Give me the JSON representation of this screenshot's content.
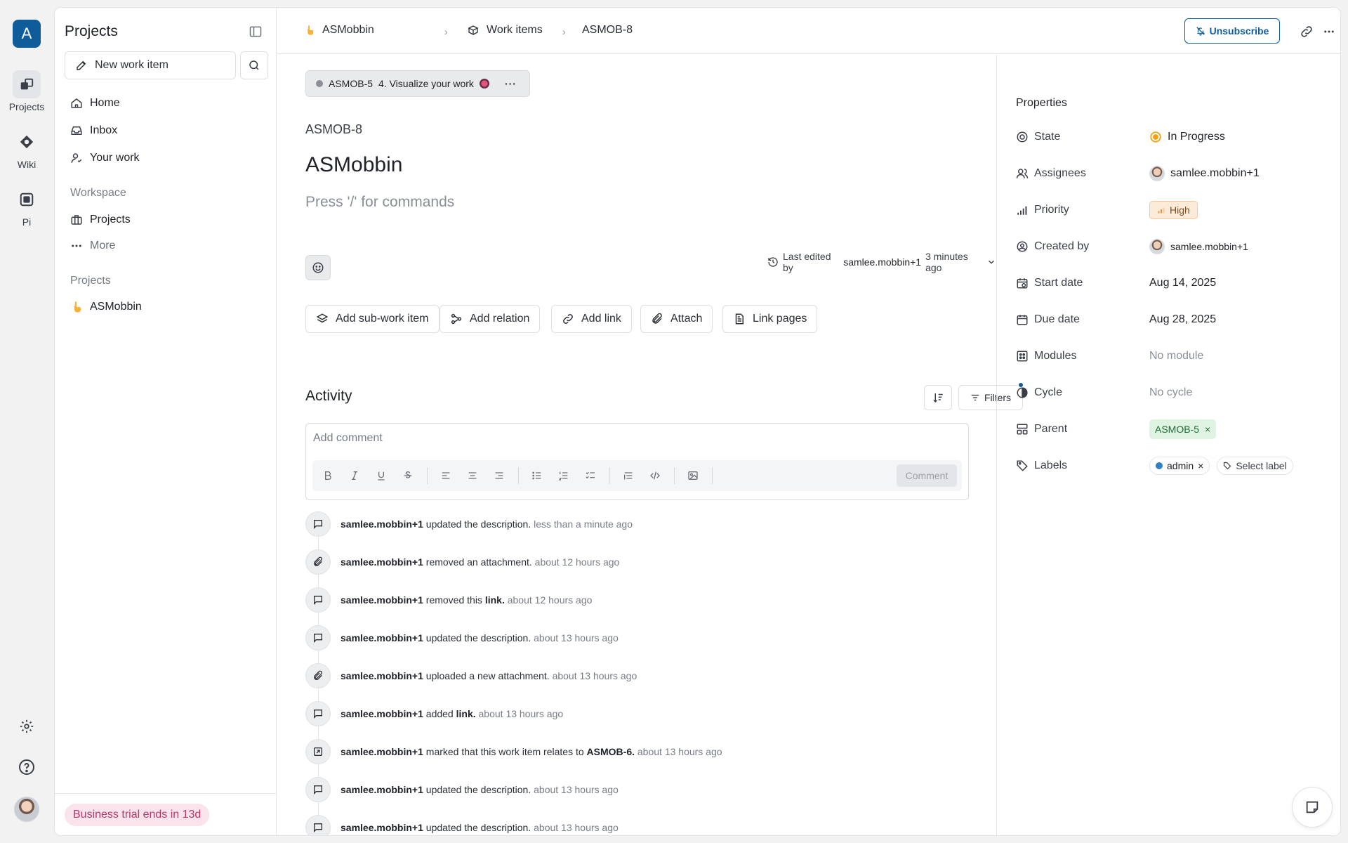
{
  "rail": {
    "workspace_initial": "A",
    "items": [
      {
        "label": "Projects",
        "icon": "projects-icon"
      },
      {
        "label": "Wiki",
        "icon": "wiki-icon"
      },
      {
        "label": "Pi",
        "icon": "pi-icon"
      }
    ]
  },
  "sidebar": {
    "title": "Projects",
    "new_item_label": "New work item",
    "nav": [
      "Home",
      "Inbox",
      "Your work"
    ],
    "workspace_heading": "Workspace",
    "workspace_items": [
      "Projects",
      "More"
    ],
    "projects_heading": "Projects",
    "project_name": "ASMobbin",
    "trial_text": "Business trial ends in 13d"
  },
  "header": {
    "breadcrumb": [
      "ASMobbin",
      "Work items",
      "ASMOB-8"
    ],
    "unsubscribe_label": "Unsubscribe"
  },
  "main": {
    "parent_chip": {
      "id": "ASMOB-5",
      "title": "4. Visualize your work"
    },
    "item_id": "ASMOB-8",
    "title": "ASMobbin",
    "description_placeholder": "Press '/' for commands",
    "last_edited": {
      "prefix": "Last edited by",
      "user": "samlee.mobbin+1",
      "time": "3 minutes ago"
    },
    "actions": [
      "Add sub-work item",
      "Add relation",
      "Add link",
      "Attach",
      "Link pages"
    ],
    "activity_title": "Activity",
    "filters_label": "Filters",
    "comment_placeholder": "Add comment",
    "comment_button": "Comment",
    "activity": [
      {
        "icon": "comment",
        "who": "samlee.mobbin+1",
        "text": "updated the description.",
        "ref": "",
        "time": "less than a minute ago"
      },
      {
        "icon": "paperclip",
        "who": "samlee.mobbin+1",
        "text": "removed an attachment.",
        "ref": "",
        "time": "about 12 hours ago"
      },
      {
        "icon": "comment",
        "who": "samlee.mobbin+1",
        "text": "removed this",
        "ref": "link.",
        "time": "about 12 hours ago"
      },
      {
        "icon": "comment",
        "who": "samlee.mobbin+1",
        "text": "updated the description.",
        "ref": "",
        "time": "about 13 hours ago"
      },
      {
        "icon": "paperclip",
        "who": "samlee.mobbin+1",
        "text": "uploaded a new attachment.",
        "ref": "",
        "time": "about 13 hours ago"
      },
      {
        "icon": "comment",
        "who": "samlee.mobbin+1",
        "text": "added",
        "ref": "link.",
        "time": "about 13 hours ago"
      },
      {
        "icon": "relation",
        "who": "samlee.mobbin+1",
        "text": "marked that this work item relates to",
        "ref": "ASMOB-6.",
        "time": "about 13 hours ago"
      },
      {
        "icon": "comment",
        "who": "samlee.mobbin+1",
        "text": "updated the description.",
        "ref": "",
        "time": "about 13 hours ago"
      },
      {
        "icon": "comment",
        "who": "samlee.mobbin+1",
        "text": "updated the description.",
        "ref": "",
        "time": "about 13 hours ago"
      }
    ]
  },
  "properties": {
    "title": "Properties",
    "state": {
      "label": "State",
      "value": "In Progress"
    },
    "assignees": {
      "label": "Assignees",
      "value": "samlee.mobbin+1"
    },
    "priority": {
      "label": "Priority",
      "value": "High"
    },
    "created_by": {
      "label": "Created by",
      "value": "samlee.mobbin+1"
    },
    "start_date": {
      "label": "Start date",
      "value": "Aug 14, 2025"
    },
    "due_date": {
      "label": "Due date",
      "value": "Aug 28, 2025"
    },
    "modules": {
      "label": "Modules",
      "value": "No module"
    },
    "cycle": {
      "label": "Cycle",
      "value": "No cycle"
    },
    "parent": {
      "label": "Parent",
      "value": "ASMOB-5"
    },
    "labels": {
      "label": "Labels",
      "value": "admin",
      "select": "Select label"
    }
  },
  "colors": {
    "accent": "#0f5c9b",
    "state_in_progress": "#f59e0b",
    "trial_bg": "#fbe3ec",
    "trial_text": "#b6386a"
  }
}
